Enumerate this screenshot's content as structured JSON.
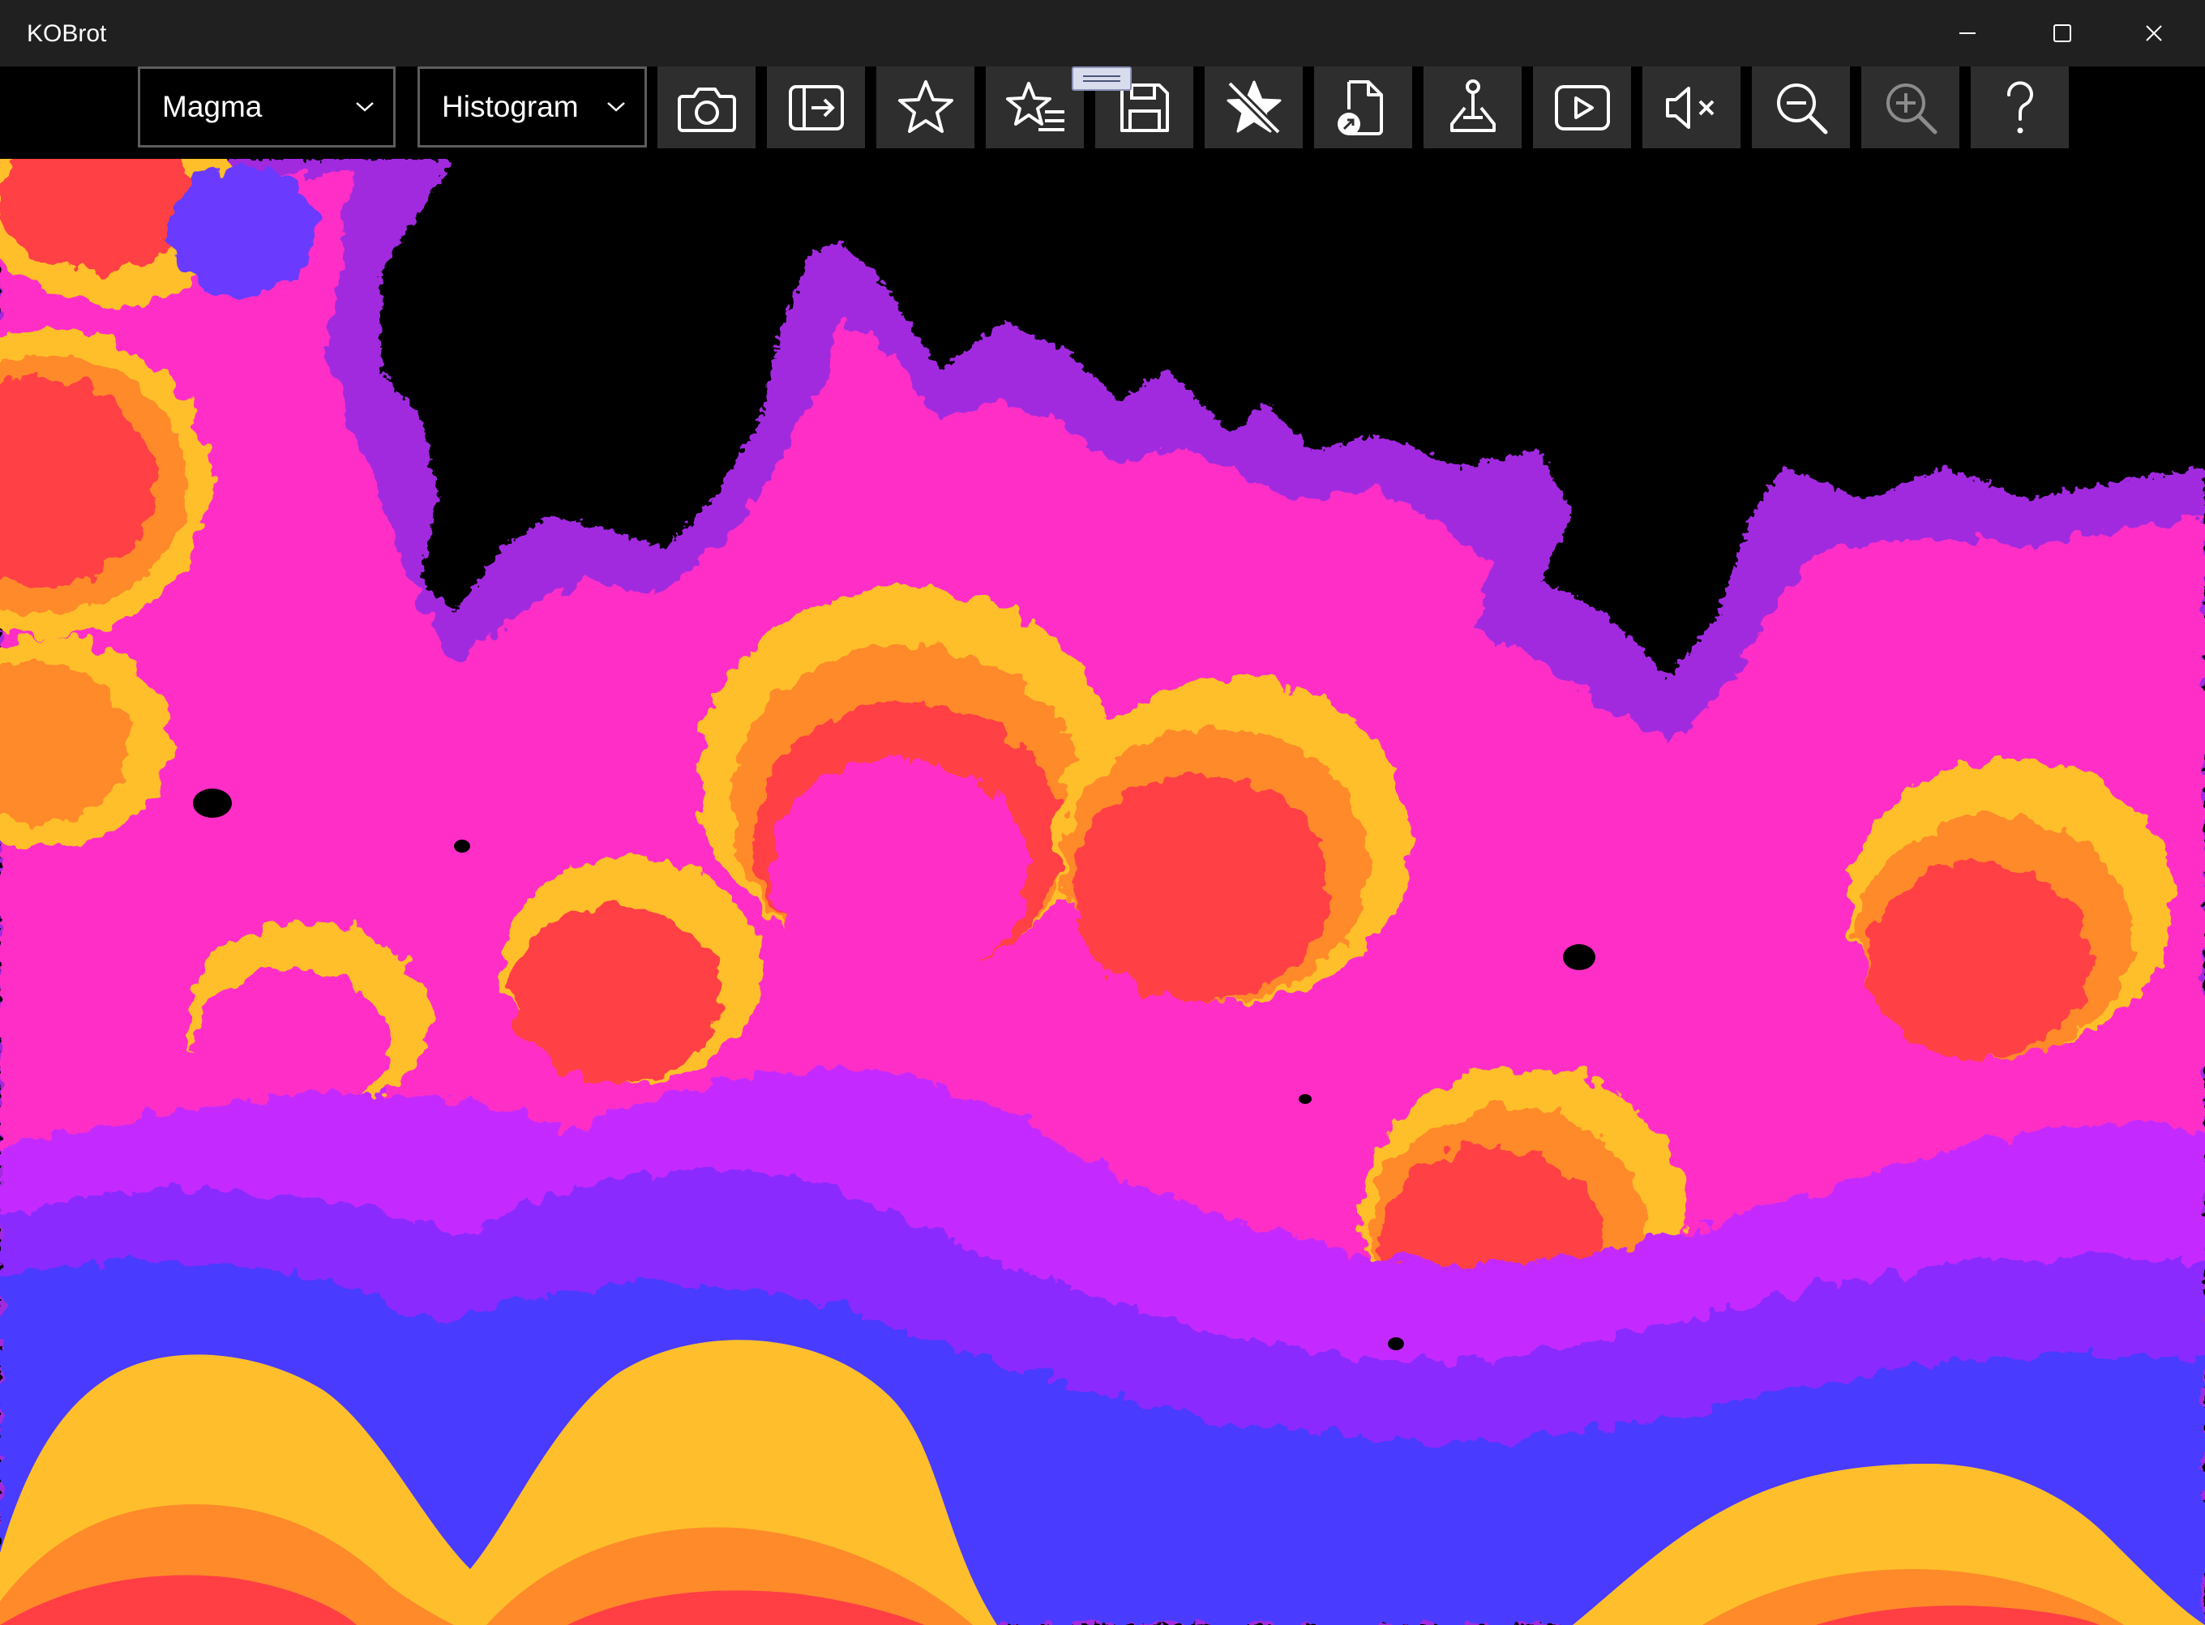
{
  "window": {
    "title": "KOBrot"
  },
  "toolbar": {
    "palette_select": {
      "value": "Magma"
    },
    "coloring_select": {
      "value": "Histogram"
    },
    "buttons": [
      {
        "icon": "camera-icon"
      },
      {
        "icon": "export-icon"
      },
      {
        "icon": "star-icon"
      },
      {
        "icon": "favorites-list-icon"
      },
      {
        "icon": "save-icon"
      },
      {
        "icon": "unfavorite-icon"
      },
      {
        "icon": "open-file-icon"
      },
      {
        "icon": "map-location-icon"
      },
      {
        "icon": "play-icon"
      },
      {
        "icon": "mute-icon"
      },
      {
        "icon": "zoom-out-icon"
      },
      {
        "icon": "zoom-in-icon",
        "disabled": true
      },
      {
        "icon": "help-icon"
      }
    ]
  },
  "palette_colors": {
    "black": "#000000",
    "yellow": "#ffbf2c",
    "orange": "#ff8a2a",
    "red": "#ff3f44",
    "pink": "#ff2ec7",
    "magenta": "#c42cff",
    "violet": "#8a2cff",
    "blue": "#4a3aff"
  }
}
